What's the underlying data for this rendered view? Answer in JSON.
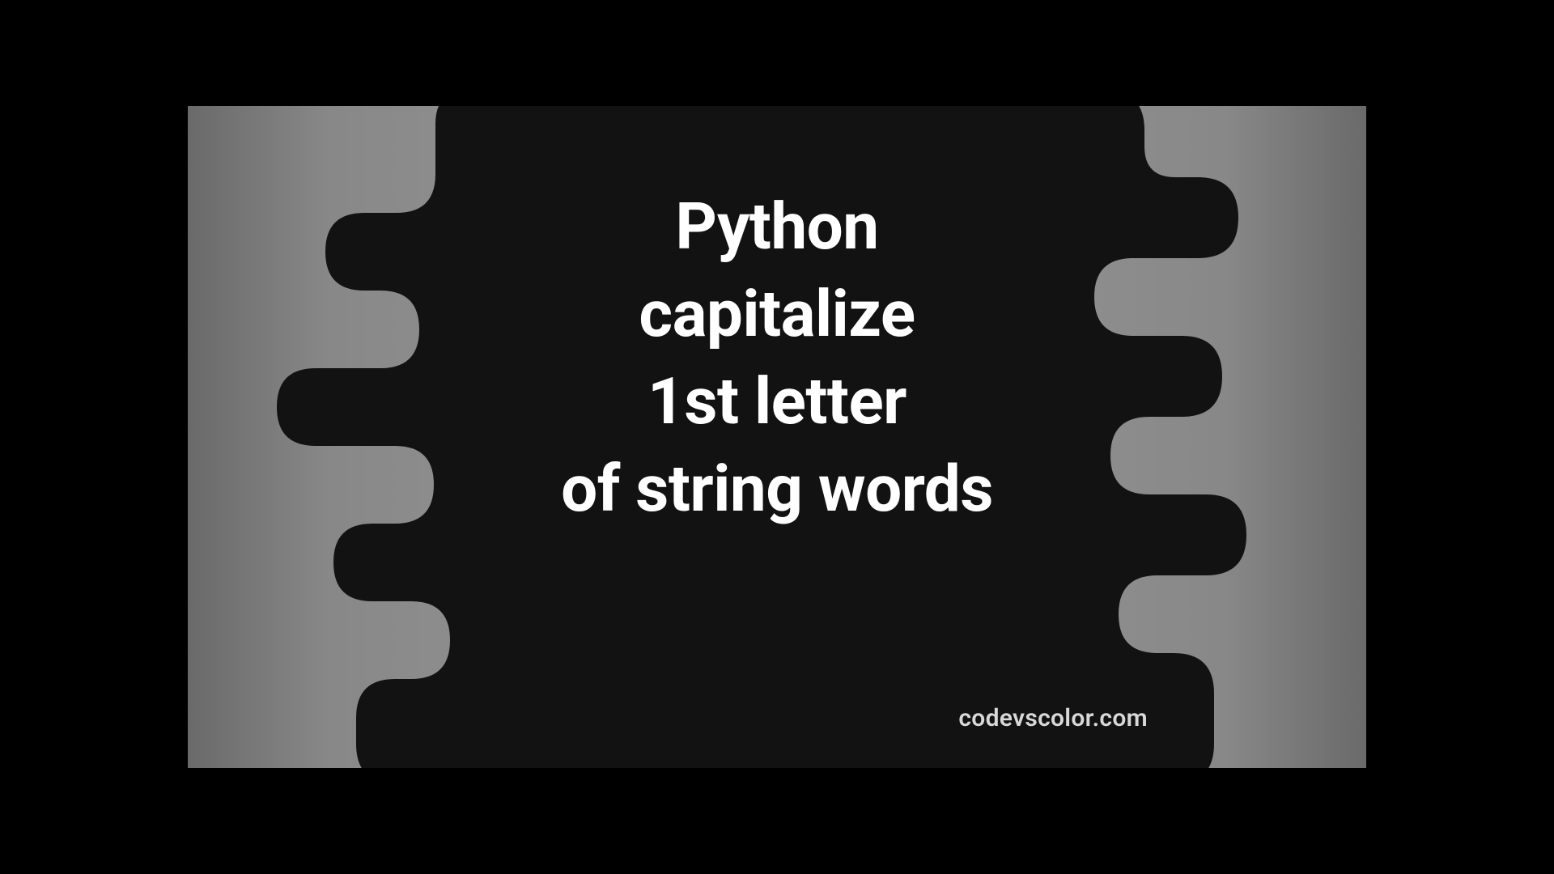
{
  "heading": {
    "line1": "Python",
    "line2": "capitalize",
    "line3": "1st letter",
    "line4": "of string words"
  },
  "watermark": "codevscolor.com",
  "colors": {
    "blob": "#121212",
    "text": "#ffffff",
    "watermark": "#d8d8d8",
    "bg_gradient_start": "#6a6a6a",
    "bg_gradient_mid": "#999999"
  }
}
